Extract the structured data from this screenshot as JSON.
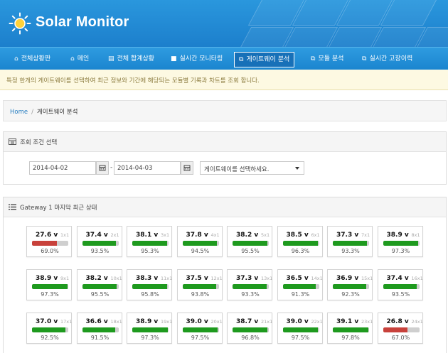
{
  "app": {
    "title": "Solar Monitor"
  },
  "nav": [
    {
      "label": "전체상황판",
      "icon": "home-icon",
      "active": false
    },
    {
      "label": "메인",
      "icon": "home-icon",
      "active": false
    },
    {
      "label": "전체 합계상황",
      "icon": "document-icon",
      "active": false
    },
    {
      "label": "실시간 모니터링",
      "icon": "video-camera-icon",
      "active": false
    },
    {
      "label": "게이트웨이 분석",
      "icon": "cubes-icon",
      "active": true
    },
    {
      "label": "모듈 분석",
      "icon": "cubes-icon",
      "active": false
    },
    {
      "label": "실시간 고장이력",
      "icon": "cubes-icon",
      "active": false
    }
  ],
  "notice": "특정 한개의 게이트웨이를 선택하여 최근 정보와 기간에 해당되는 모듈별 기록과 차트를 조회 합니다.",
  "breadcrumb": {
    "home": "Home",
    "separator": "/",
    "current": "게이트웨이 분석"
  },
  "query": {
    "title": "조회 조건 선택",
    "start_date": "2014-04-02",
    "dash": "-",
    "end_date": "2014-04-03",
    "gateway_select": "게이트웨이를 선택하세요."
  },
  "status": {
    "title": "Gateway 1 마지막 최근 상태",
    "tiles": [
      {
        "voltage": "27.6 v",
        "id": "1x1",
        "percent": 69.0,
        "percent_label": "69.0%"
      },
      {
        "voltage": "37.4 v",
        "id": "2x1",
        "percent": 93.5,
        "percent_label": "93.5%"
      },
      {
        "voltage": "38.1 v",
        "id": "3x1",
        "percent": 95.3,
        "percent_label": "95.3%"
      },
      {
        "voltage": "37.8 v",
        "id": "4x1",
        "percent": 94.5,
        "percent_label": "94.5%"
      },
      {
        "voltage": "38.2 v",
        "id": "5x1",
        "percent": 95.5,
        "percent_label": "95.5%"
      },
      {
        "voltage": "38.5 v",
        "id": "6x1",
        "percent": 96.3,
        "percent_label": "96.3%"
      },
      {
        "voltage": "37.3 v",
        "id": "7x1",
        "percent": 93.3,
        "percent_label": "93.3%"
      },
      {
        "voltage": "38.9 v",
        "id": "8x1",
        "percent": 97.3,
        "percent_label": "97.3%"
      },
      {
        "voltage": "38.9 v",
        "id": "9x1",
        "percent": 97.3,
        "percent_label": "97.3%"
      },
      {
        "voltage": "38.2 v",
        "id": "10x1",
        "percent": 95.5,
        "percent_label": "95.5%"
      },
      {
        "voltage": "38.3 v",
        "id": "11x1",
        "percent": 95.8,
        "percent_label": "95.8%"
      },
      {
        "voltage": "37.5 v",
        "id": "12x1",
        "percent": 93.8,
        "percent_label": "93.8%"
      },
      {
        "voltage": "37.3 v",
        "id": "13x1",
        "percent": 93.3,
        "percent_label": "93.3%"
      },
      {
        "voltage": "36.5 v",
        "id": "14x1",
        "percent": 91.3,
        "percent_label": "91.3%"
      },
      {
        "voltage": "36.9 v",
        "id": "15x1",
        "percent": 92.3,
        "percent_label": "92.3%"
      },
      {
        "voltage": "37.4 v",
        "id": "16x1",
        "percent": 93.5,
        "percent_label": "93.5%"
      },
      {
        "voltage": "37.0 v",
        "id": "17x1",
        "percent": 92.5,
        "percent_label": "92.5%"
      },
      {
        "voltage": "36.6 v",
        "id": "18x1",
        "percent": 91.5,
        "percent_label": "91.5%"
      },
      {
        "voltage": "38.9 v",
        "id": "19x1",
        "percent": 97.3,
        "percent_label": "97.3%"
      },
      {
        "voltage": "39.0 v",
        "id": "20x1",
        "percent": 97.5,
        "percent_label": "97.5%"
      },
      {
        "voltage": "38.7 v",
        "id": "21x1",
        "percent": 96.8,
        "percent_label": "96.8%"
      },
      {
        "voltage": "39.0 v",
        "id": "22x1",
        "percent": 97.5,
        "percent_label": "97.5%"
      },
      {
        "voltage": "39.1 v",
        "id": "23x1",
        "percent": 97.8,
        "percent_label": "97.8%"
      },
      {
        "voltage": "26.8 v",
        "id": "24x1",
        "percent": 67.0,
        "percent_label": "67.0%"
      }
    ]
  },
  "colors": {
    "header": "#1c7fcc",
    "bar_ok": "#1e9a1e",
    "bar_low": "#c8413b",
    "bar_track": "#cfcfcf"
  }
}
